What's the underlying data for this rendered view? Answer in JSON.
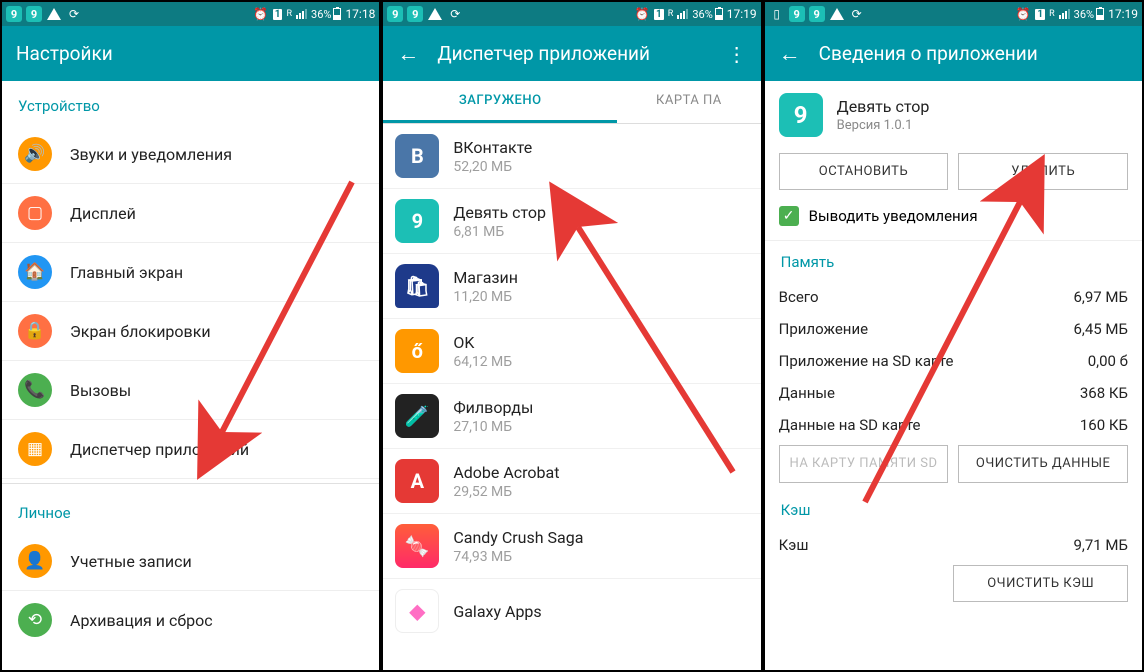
{
  "status": {
    "battery": "36%",
    "time1": "17:18",
    "time2": "17:19",
    "time3": "17:19",
    "sim_label": "1",
    "net_label": "R"
  },
  "pane1": {
    "title": "Настройки",
    "sections": {
      "device": "Устройство",
      "personal": "Личное"
    },
    "items": {
      "sound": "Звуки и уведомления",
      "display": "Дисплей",
      "home": "Главный экран",
      "lock": "Экран блокировки",
      "calls": "Вызовы",
      "apps": "Диспетчер приложений",
      "accounts": "Учетные записи",
      "backup": "Архивация и сброс"
    }
  },
  "pane2": {
    "title": "Диспетчер приложений",
    "tabs": {
      "downloaded": "ЗАГРУЖЕНО",
      "sdcard": "КАРТА ПА"
    },
    "apps": {
      "vk": {
        "name": "ВКонтакте",
        "size": "52,20 МБ"
      },
      "nine": {
        "name": "Девять стор",
        "size": "6,81 МБ"
      },
      "shop": {
        "name": "Магазин",
        "size": "11,20 МБ"
      },
      "ok": {
        "name": "OK",
        "size": "64,12 МБ"
      },
      "fil": {
        "name": "Филворды",
        "size": "27,10 МБ"
      },
      "acro": {
        "name": "Adobe Acrobat",
        "size": "29,52 МБ"
      },
      "candy": {
        "name": "Candy Crush Saga",
        "size": "74,93 МБ"
      },
      "galaxy": {
        "name": "Galaxy Apps",
        "size": ""
      }
    }
  },
  "pane3": {
    "title": "Сведения о приложении",
    "app_name": "Девять стор",
    "version": "Версия 1.0.1",
    "buttons": {
      "stop": "ОСТАНОВИТЬ",
      "delete": "УДАЛИТЬ",
      "to_sd": "НА КАРТУ ПАМЯТИ SD",
      "clear_data": "ОЧИСТИТЬ ДАННЫЕ",
      "clear_cache": "ОЧИСТИТЬ КЭШ"
    },
    "notify_label": "Выводить уведомления",
    "headers": {
      "memory": "Память",
      "cache": "Кэш"
    },
    "memory": {
      "total_l": "Всего",
      "total_v": "6,97 МБ",
      "app_l": "Приложение",
      "app_v": "6,45 МБ",
      "sdapp_l": "Приложение на SD карте",
      "sdapp_v": "0,00 б",
      "data_l": "Данные",
      "data_v": "368 КБ",
      "sddata_l": "Данные на SD карте",
      "sddata_v": "160 КБ"
    },
    "cache": {
      "l": "Кэш",
      "v": "9,71 МБ"
    }
  }
}
